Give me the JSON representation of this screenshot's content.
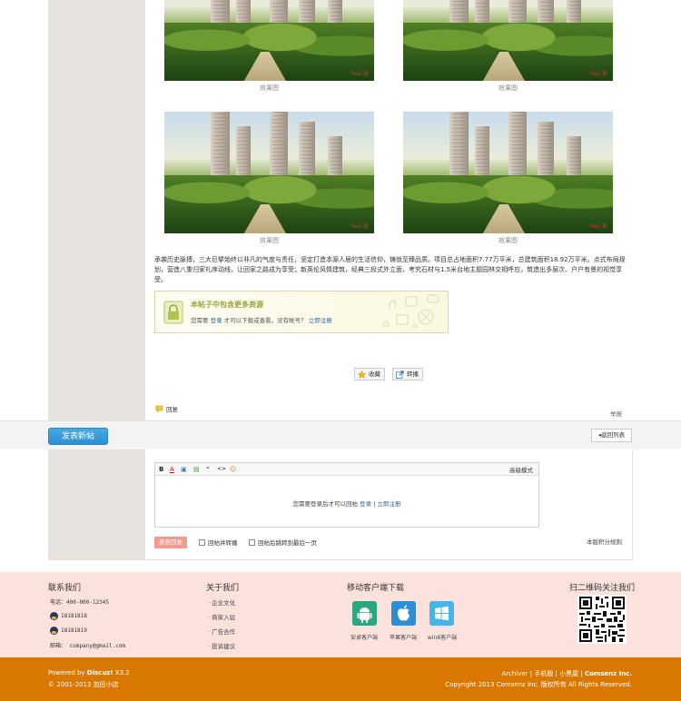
{
  "post": {
    "images": [
      {
        "caption": "效果图",
        "watermark": "Rea 泉"
      },
      {
        "caption": "效果图",
        "watermark": "Rea 泉"
      },
      {
        "caption": "效果图",
        "watermark": "Rea 泉"
      },
      {
        "caption": "效果图",
        "watermark": "Rea 泉"
      }
    ],
    "body_text": "承袭历史脉搏，三大巨擘始终以非凡的气度与责任，坚定打造本源人居的生活信仰，铸就至臻品质。项目总占地面积7.77万平米，总建筑面积18.92万平米。点式布局规划，营造八重归家礼序动线，让回家之路成为享受；新英伦风情建筑，经典三段式外立面，考究石材与1.5米台地主题园林交相呼应，筑造出多层次、户户有景的视觉享受。",
    "locked": {
      "title": "本帖子中包含更多资源",
      "prefix": "您需要",
      "login": "登录",
      "middle": "才可以下载或查看，没有帐号？",
      "register": "立即注册"
    },
    "actions": {
      "favorite": "收藏",
      "share": "转播"
    },
    "reply": "回复",
    "report": "举报"
  },
  "bar": {
    "new_thread": "发表新帖",
    "back_list": "返回列表"
  },
  "editor": {
    "toolbar": [
      "B",
      "A",
      "▣",
      "▤",
      "“",
      "<>",
      "☺"
    ],
    "advanced": "高级模式",
    "msg_prefix": "您需要登录后才可以回帖",
    "login": "登录",
    "sep": "|",
    "register": "立即注册",
    "submit": "发表回复",
    "check1": "回帖并转播",
    "check2": "回帖后跳转到最后一页",
    "rules": "本版积分规则"
  },
  "footer": {
    "contact_title": "联系我们",
    "phone": "电话：400-000-12345",
    "qq1": "18181818",
    "qq2": "18181819",
    "email": "邮箱： company@gmail.com",
    "about_title": "关于我们",
    "about_items": [
      "企业文化",
      "商家入驻",
      "广告合作",
      "投诉建议"
    ],
    "mobile_title": "移动客户端下载",
    "apps": [
      "安卓客户端",
      "苹果客户端",
      "win8客户端"
    ],
    "qr_title": "扫二维码关注我们",
    "powered_prefix": "Powered by ",
    "powered_name": "Discuz!",
    "powered_ver": " X3.2",
    "copyright_left": "© 2001-2013 加田小店",
    "links_right": "Archiver | 手机版 | 小黑屋 | ",
    "company": "Comsenz Inc.",
    "copyright_right": "Copyright 2013 Comsenz Inc. 版权所有 All Rights Reserved."
  },
  "colors": {
    "accent_blue": "#2b8fd3",
    "footer_bg": "#fbe2dd",
    "bottom_bar": "#d97800",
    "submit_btn": "#f29b8c"
  }
}
